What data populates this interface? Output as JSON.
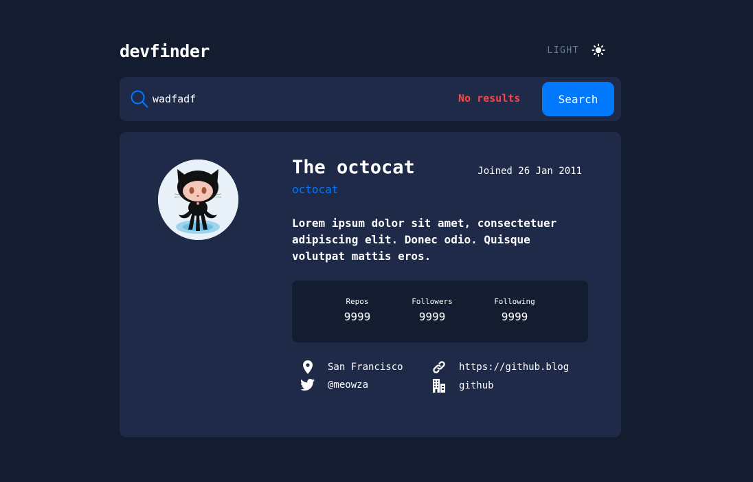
{
  "app": {
    "title": "devfinder",
    "theme_toggle_label": "LIGHT",
    "theme_icon": "sun-icon"
  },
  "search": {
    "value": "wadfadf",
    "placeholder": "",
    "error": "No results",
    "button_label": "Search"
  },
  "profile": {
    "name": "The octocat",
    "joined": "Joined 26 Jan 2011",
    "login": "octocat",
    "bio": "Lorem ipsum dolor sit amet, consectetuer adipiscing elit. Donec odio. Quisque volutpat mattis eros.",
    "stats": [
      {
        "label": "Repos",
        "value": "9999"
      },
      {
        "label": "Followers",
        "value": "9999"
      },
      {
        "label": "Following",
        "value": "9999"
      }
    ],
    "links": {
      "location": "San Francisco",
      "blog": "https://github.blog",
      "twitter": "@meowza",
      "company": "github"
    }
  },
  "colors": {
    "background": "#141d2f",
    "card": "#1e2a47",
    "accent": "#0079ff",
    "error": "#f74646",
    "muted": "#697c9a"
  }
}
